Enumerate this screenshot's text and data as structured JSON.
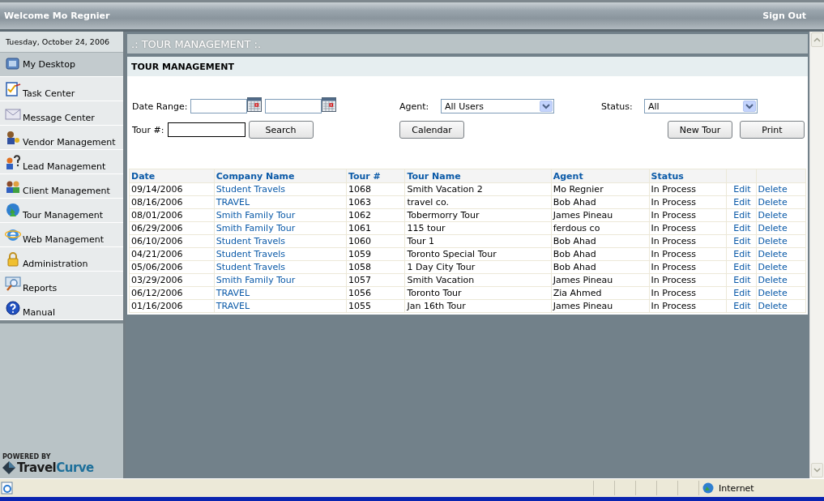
{
  "header": {
    "welcome": "Welcome Mo Regnier",
    "sign_out": "Sign Out"
  },
  "sidebar": {
    "date": "Tuesday, October 24, 2006",
    "items": [
      {
        "label": "My Desktop",
        "selected": true
      },
      {
        "label": "Task Center",
        "selected": false
      },
      {
        "label": "Message Center",
        "selected": false
      },
      {
        "label": "Vendor Management",
        "selected": false
      },
      {
        "label": "Lead Management",
        "selected": false
      },
      {
        "label": "Client Management",
        "selected": false
      },
      {
        "label": "Tour Management",
        "selected": false
      },
      {
        "label": "Web Management",
        "selected": false
      },
      {
        "label": "Administration",
        "selected": false
      },
      {
        "label": "Reports",
        "selected": false
      },
      {
        "label": "Manual",
        "selected": false
      }
    ],
    "logo": {
      "tagline": "POWERED BY",
      "word_1": "Travel",
      "word_2": "Curve"
    }
  },
  "page_title": ".: TOUR MANAGEMENT :.",
  "panel": {
    "title": "TOUR MANAGEMENT",
    "filters": {
      "date_range_label": "Date Range:",
      "tour_number_label": "Tour #:",
      "agent_label": "Agent:",
      "agent_value": "All Users",
      "status_label": "Status:",
      "status_value": "All"
    },
    "buttons": {
      "search": "Search",
      "calendar": "Calendar",
      "new_tour": "New Tour",
      "print": "Print"
    }
  },
  "table": {
    "columns": [
      "Date",
      "Company Name",
      "Tour #",
      "Tour Name",
      "Agent",
      "Status"
    ],
    "rows": [
      {
        "date": "09/14/2006",
        "company": "Student Travels",
        "tour_number": "1068",
        "tour_name": "Smith Vacation 2",
        "agent": "Mo Regnier",
        "status": "In Process",
        "edit": "Edit",
        "delete": "Delete"
      },
      {
        "date": "08/16/2006",
        "company": "TRAVEL",
        "tour_number": "1063",
        "tour_name": "travel co.",
        "agent": "Bob Ahad",
        "status": "In Process",
        "edit": "Edit",
        "delete": "Delete"
      },
      {
        "date": "08/01/2006",
        "company": "Smith Family Tour",
        "tour_number": "1062",
        "tour_name": "Tobermorry Tour",
        "agent": "James Pineau",
        "status": "In Process",
        "edit": "Edit",
        "delete": "Delete"
      },
      {
        "date": "06/29/2006",
        "company": "Smith Family Tour",
        "tour_number": "1061",
        "tour_name": "115 tour",
        "agent": "ferdous co",
        "status": "In Process",
        "edit": "Edit",
        "delete": "Delete"
      },
      {
        "date": "06/10/2006",
        "company": "Student Travels",
        "tour_number": "1060",
        "tour_name": "Tour 1",
        "agent": "Bob Ahad",
        "status": "In Process",
        "edit": "Edit",
        "delete": "Delete"
      },
      {
        "date": "04/21/2006",
        "company": "Student Travels",
        "tour_number": "1059",
        "tour_name": "Toronto Special Tour",
        "agent": "Bob Ahad",
        "status": "In Process",
        "edit": "Edit",
        "delete": "Delete"
      },
      {
        "date": "05/06/2006",
        "company": "Student Travels",
        "tour_number": "1058",
        "tour_name": "1 Day City Tour",
        "agent": "Bob Ahad",
        "status": "In Process",
        "edit": "Edit",
        "delete": "Delete"
      },
      {
        "date": "03/29/2006",
        "company": "Smith Family Tour",
        "tour_number": "1057",
        "tour_name": "Smith Vacation",
        "agent": "James Pineau",
        "status": "In Process",
        "edit": "Edit",
        "delete": "Delete"
      },
      {
        "date": "06/12/2006",
        "company": "TRAVEL",
        "tour_number": "1056",
        "tour_name": "Toronto Tour",
        "agent": "Zia Ahmed",
        "status": "In Process",
        "edit": "Edit",
        "delete": "Delete"
      },
      {
        "date": "01/16/2006",
        "company": "TRAVEL",
        "tour_number": "1055",
        "tour_name": "Jan 16th Tour",
        "agent": "James Pineau",
        "status": "In Process",
        "edit": "Edit",
        "delete": "Delete"
      }
    ]
  },
  "status_bar": {
    "zone": "Internet"
  }
}
